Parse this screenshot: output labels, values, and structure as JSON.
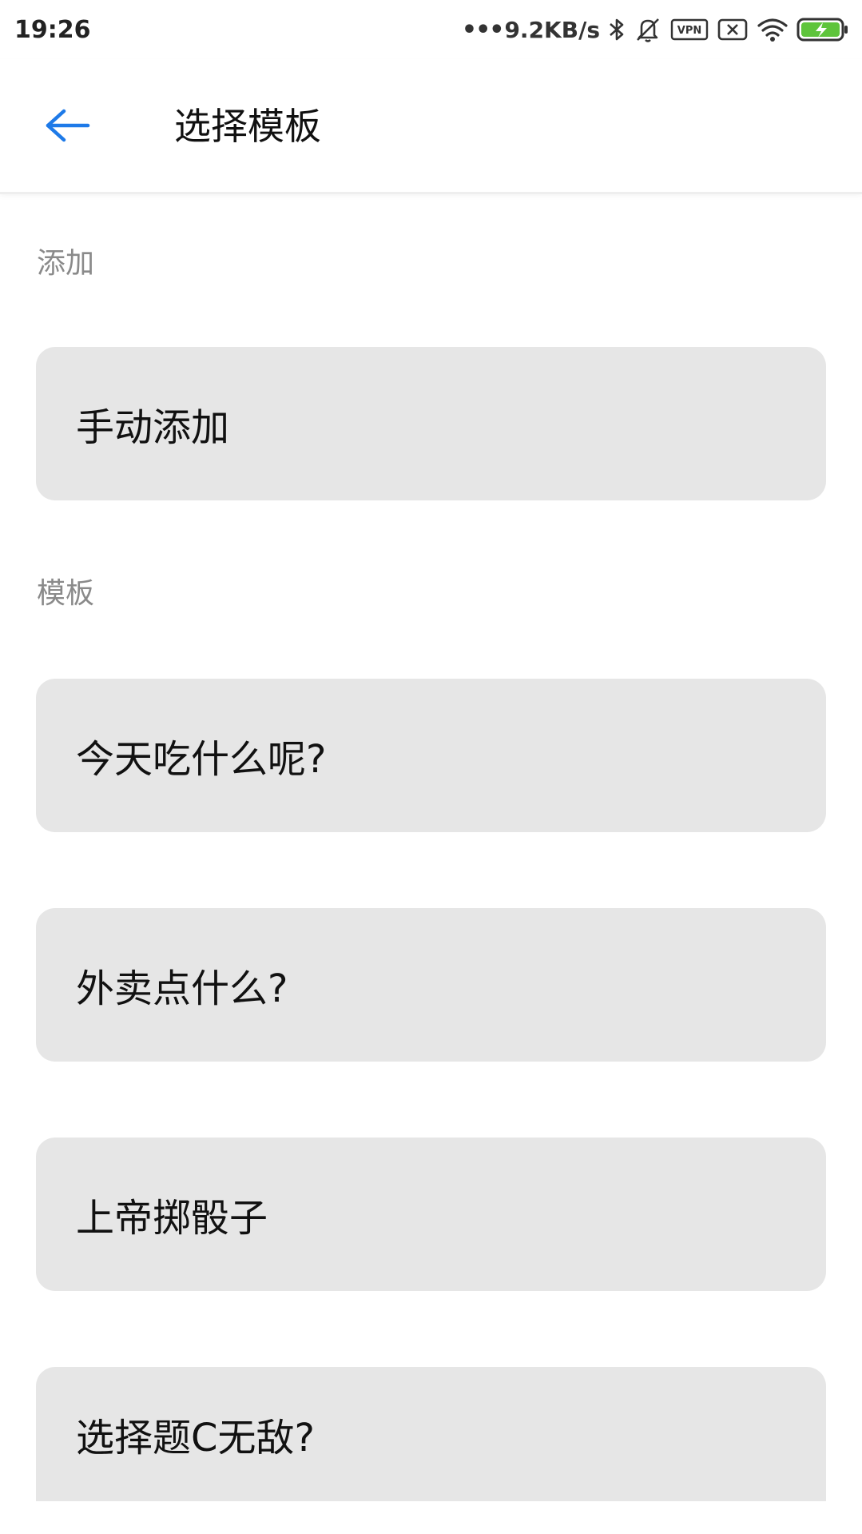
{
  "status_bar": {
    "time": "19:26",
    "net_speed": "9.2KB/s",
    "icons": [
      "bluetooth-icon",
      "mute-icon",
      "vpn-icon",
      "no-sim-icon",
      "wifi-icon",
      "battery-charging-icon"
    ],
    "vpn_label": "VPN",
    "battery_color": "#5ec43b"
  },
  "app_bar": {
    "title": "选择模板",
    "back_icon": "back-arrow-icon",
    "accent_color": "#1e7ae8"
  },
  "sections": {
    "add": {
      "label": "添加",
      "items": [
        "手动添加"
      ]
    },
    "templates": {
      "label": "模板",
      "items": [
        "今天吃什么呢?",
        "外卖点什么?",
        "上帝掷骰子",
        "选择题C无敌?"
      ]
    }
  }
}
